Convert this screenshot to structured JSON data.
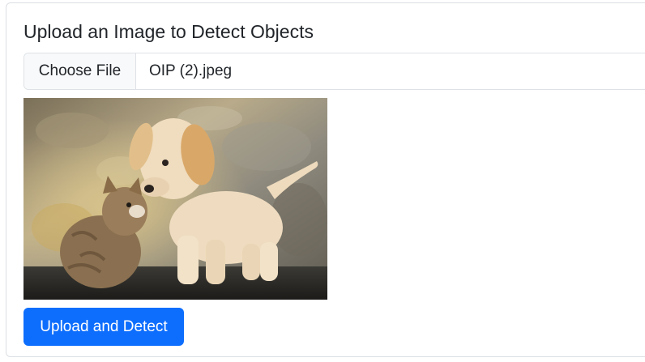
{
  "form": {
    "title": "Upload an Image to Detect Objects",
    "file_input": {
      "button_label": "Choose File",
      "selected_file": "OIP (2).jpeg"
    },
    "preview_image": {
      "subject": "puppy and kitten on stone background"
    },
    "submit_label": "Upload and Detect"
  },
  "colors": {
    "primary": "#0d6efd",
    "text": "#212529",
    "border": "#dee2e6",
    "file_button_bg": "#f8f9fa"
  }
}
